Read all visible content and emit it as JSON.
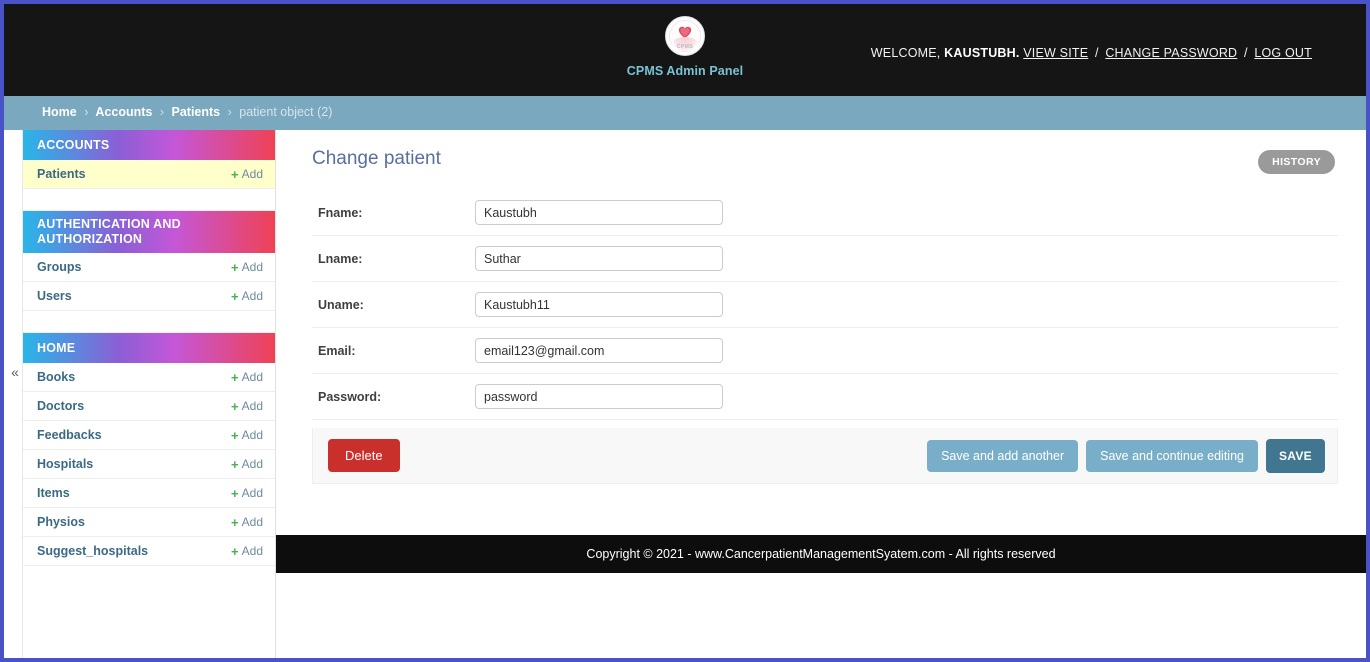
{
  "header": {
    "brand_title": "CPMS Admin Panel",
    "logo_mark": "CPMS",
    "welcome_prefix": "WELCOME,",
    "username": "KAUSTUBH.",
    "links": [
      {
        "label": "VIEW SITE"
      },
      {
        "label": "CHANGE PASSWORD"
      },
      {
        "label": "LOG OUT"
      }
    ],
    "separator": "/"
  },
  "breadcrumbs": {
    "separator": "›",
    "items": [
      {
        "label": "Home",
        "current": false
      },
      {
        "label": "Accounts",
        "current": false
      },
      {
        "label": "Patients",
        "current": false
      },
      {
        "label": "patient object (2)",
        "current": true
      }
    ]
  },
  "sidebar": {
    "collapse_icon": "«",
    "add_label": "Add",
    "add_icon": "+",
    "apps": [
      {
        "title": "ACCOUNTS",
        "models": [
          {
            "label": "Patients",
            "current": true
          }
        ]
      },
      {
        "title": "AUTHENTICATION AND AUTHORIZATION",
        "two_line": true,
        "models": [
          {
            "label": "Groups",
            "current": false
          },
          {
            "label": "Users",
            "current": false
          }
        ]
      },
      {
        "title": "HOME",
        "models": [
          {
            "label": "Books",
            "current": false
          },
          {
            "label": "Doctors",
            "current": false
          },
          {
            "label": "Feedbacks",
            "current": false
          },
          {
            "label": "Hospitals",
            "current": false
          },
          {
            "label": "Items",
            "current": false
          },
          {
            "label": "Physios",
            "current": false
          },
          {
            "label": "Suggest_hospitals",
            "current": false
          }
        ]
      }
    ]
  },
  "content": {
    "page_title": "Change patient",
    "history_label": "HISTORY",
    "fields": [
      {
        "label": "Fname:",
        "value": "Kaustubh",
        "placeholder": ""
      },
      {
        "label": "Lname:",
        "value": "Suthar",
        "placeholder": ""
      },
      {
        "label": "Uname:",
        "value": "Kaustubh11",
        "placeholder": ""
      },
      {
        "label": "Email:",
        "value": "email123@gmail.com",
        "placeholder": ""
      },
      {
        "label": "Password:",
        "value": "password",
        "placeholder": ""
      }
    ],
    "actions": {
      "delete_label": "Delete",
      "save_add_another_label": "Save and add another",
      "save_continue_label": "Save and continue editing",
      "save_label": "SAVE"
    }
  },
  "footer": {
    "text": "Copyright © 2021 - www.CancerpatientManagementSyatem.com - All rights reserved"
  },
  "colors": {
    "accent_blue": "#417690",
    "secondary_blue": "#79aec8",
    "danger_red": "#c9302c",
    "breadcrumb_bg": "#79a8bf",
    "header_bg": "#151515",
    "current_row": "#ffffcc",
    "frame_border": "#4a52c8",
    "brand_text": "#79c3d6",
    "add_green": "#4caf50"
  }
}
